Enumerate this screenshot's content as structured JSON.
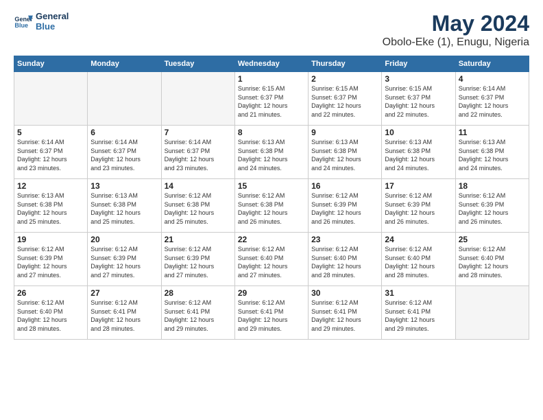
{
  "logo": {
    "line1": "General",
    "line2": "Blue"
  },
  "title": "May 2024",
  "subtitle": "Obolo-Eke (1), Enugu, Nigeria",
  "days": [
    "Sunday",
    "Monday",
    "Tuesday",
    "Wednesday",
    "Thursday",
    "Friday",
    "Saturday"
  ],
  "weeks": [
    [
      {
        "day": "",
        "info": ""
      },
      {
        "day": "",
        "info": ""
      },
      {
        "day": "",
        "info": ""
      },
      {
        "day": "1",
        "info": "Sunrise: 6:15 AM\nSunset: 6:37 PM\nDaylight: 12 hours\nand 21 minutes."
      },
      {
        "day": "2",
        "info": "Sunrise: 6:15 AM\nSunset: 6:37 PM\nDaylight: 12 hours\nand 22 minutes."
      },
      {
        "day": "3",
        "info": "Sunrise: 6:15 AM\nSunset: 6:37 PM\nDaylight: 12 hours\nand 22 minutes."
      },
      {
        "day": "4",
        "info": "Sunrise: 6:14 AM\nSunset: 6:37 PM\nDaylight: 12 hours\nand 22 minutes."
      }
    ],
    [
      {
        "day": "5",
        "info": "Sunrise: 6:14 AM\nSunset: 6:37 PM\nDaylight: 12 hours\nand 23 minutes."
      },
      {
        "day": "6",
        "info": "Sunrise: 6:14 AM\nSunset: 6:37 PM\nDaylight: 12 hours\nand 23 minutes."
      },
      {
        "day": "7",
        "info": "Sunrise: 6:14 AM\nSunset: 6:37 PM\nDaylight: 12 hours\nand 23 minutes."
      },
      {
        "day": "8",
        "info": "Sunrise: 6:13 AM\nSunset: 6:38 PM\nDaylight: 12 hours\nand 24 minutes."
      },
      {
        "day": "9",
        "info": "Sunrise: 6:13 AM\nSunset: 6:38 PM\nDaylight: 12 hours\nand 24 minutes."
      },
      {
        "day": "10",
        "info": "Sunrise: 6:13 AM\nSunset: 6:38 PM\nDaylight: 12 hours\nand 24 minutes."
      },
      {
        "day": "11",
        "info": "Sunrise: 6:13 AM\nSunset: 6:38 PM\nDaylight: 12 hours\nand 24 minutes."
      }
    ],
    [
      {
        "day": "12",
        "info": "Sunrise: 6:13 AM\nSunset: 6:38 PM\nDaylight: 12 hours\nand 25 minutes."
      },
      {
        "day": "13",
        "info": "Sunrise: 6:13 AM\nSunset: 6:38 PM\nDaylight: 12 hours\nand 25 minutes."
      },
      {
        "day": "14",
        "info": "Sunrise: 6:12 AM\nSunset: 6:38 PM\nDaylight: 12 hours\nand 25 minutes."
      },
      {
        "day": "15",
        "info": "Sunrise: 6:12 AM\nSunset: 6:38 PM\nDaylight: 12 hours\nand 26 minutes."
      },
      {
        "day": "16",
        "info": "Sunrise: 6:12 AM\nSunset: 6:39 PM\nDaylight: 12 hours\nand 26 minutes."
      },
      {
        "day": "17",
        "info": "Sunrise: 6:12 AM\nSunset: 6:39 PM\nDaylight: 12 hours\nand 26 minutes."
      },
      {
        "day": "18",
        "info": "Sunrise: 6:12 AM\nSunset: 6:39 PM\nDaylight: 12 hours\nand 26 minutes."
      }
    ],
    [
      {
        "day": "19",
        "info": "Sunrise: 6:12 AM\nSunset: 6:39 PM\nDaylight: 12 hours\nand 27 minutes."
      },
      {
        "day": "20",
        "info": "Sunrise: 6:12 AM\nSunset: 6:39 PM\nDaylight: 12 hours\nand 27 minutes."
      },
      {
        "day": "21",
        "info": "Sunrise: 6:12 AM\nSunset: 6:39 PM\nDaylight: 12 hours\nand 27 minutes."
      },
      {
        "day": "22",
        "info": "Sunrise: 6:12 AM\nSunset: 6:40 PM\nDaylight: 12 hours\nand 27 minutes."
      },
      {
        "day": "23",
        "info": "Sunrise: 6:12 AM\nSunset: 6:40 PM\nDaylight: 12 hours\nand 28 minutes."
      },
      {
        "day": "24",
        "info": "Sunrise: 6:12 AM\nSunset: 6:40 PM\nDaylight: 12 hours\nand 28 minutes."
      },
      {
        "day": "25",
        "info": "Sunrise: 6:12 AM\nSunset: 6:40 PM\nDaylight: 12 hours\nand 28 minutes."
      }
    ],
    [
      {
        "day": "26",
        "info": "Sunrise: 6:12 AM\nSunset: 6:40 PM\nDaylight: 12 hours\nand 28 minutes."
      },
      {
        "day": "27",
        "info": "Sunrise: 6:12 AM\nSunset: 6:41 PM\nDaylight: 12 hours\nand 28 minutes."
      },
      {
        "day": "28",
        "info": "Sunrise: 6:12 AM\nSunset: 6:41 PM\nDaylight: 12 hours\nand 29 minutes."
      },
      {
        "day": "29",
        "info": "Sunrise: 6:12 AM\nSunset: 6:41 PM\nDaylight: 12 hours\nand 29 minutes."
      },
      {
        "day": "30",
        "info": "Sunrise: 6:12 AM\nSunset: 6:41 PM\nDaylight: 12 hours\nand 29 minutes."
      },
      {
        "day": "31",
        "info": "Sunrise: 6:12 AM\nSunset: 6:41 PM\nDaylight: 12 hours\nand 29 minutes."
      },
      {
        "day": "",
        "info": ""
      }
    ]
  ]
}
